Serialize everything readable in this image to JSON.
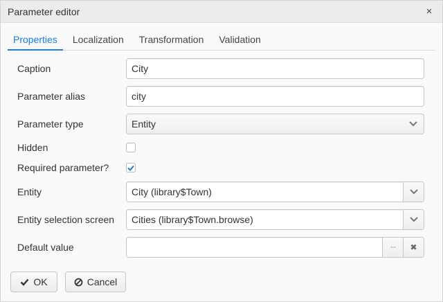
{
  "window": {
    "title": "Parameter editor",
    "close_glyph": "×"
  },
  "tabs": [
    {
      "label": "Properties",
      "active": true
    },
    {
      "label": "Localization",
      "active": false
    },
    {
      "label": "Transformation",
      "active": false
    },
    {
      "label": "Validation",
      "active": false
    }
  ],
  "form": {
    "caption": {
      "label": "Caption",
      "value": "City"
    },
    "alias": {
      "label": "Parameter alias",
      "value": "city"
    },
    "type": {
      "label": "Parameter type",
      "value": "Entity"
    },
    "hidden": {
      "label": "Hidden",
      "checked": false
    },
    "required": {
      "label": "Required parameter?",
      "checked": true
    },
    "entity": {
      "label": "Entity",
      "value": "City (library$Town)"
    },
    "screen": {
      "label": "Entity selection screen",
      "value": "Cities (library$Town.browse)"
    },
    "default": {
      "label": "Default value",
      "value": "",
      "lookup_glyph": "···",
      "clear_glyph": "✖"
    }
  },
  "footer": {
    "ok_label": "OK",
    "cancel_label": "Cancel"
  },
  "colors": {
    "accent": "#197de1"
  }
}
